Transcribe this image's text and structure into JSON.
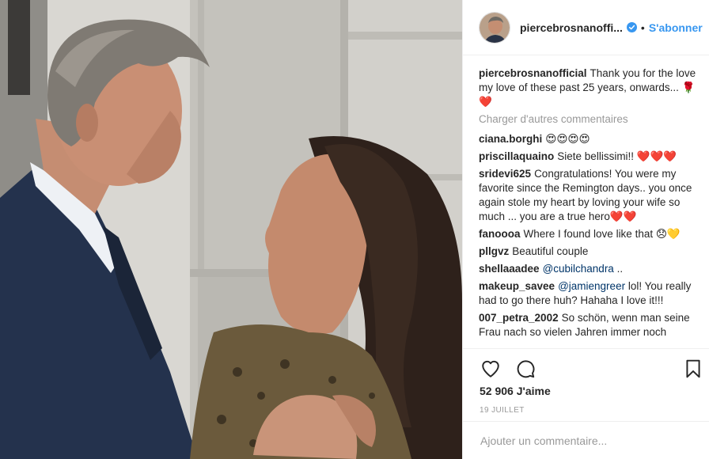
{
  "post": {
    "photo_alt": "photo-of-couple",
    "header": {
      "username": "piercebrosnanoffi...",
      "separator": "•",
      "follow_label": "S'abonner",
      "verified_icon": "verified-badge-icon"
    },
    "caption": {
      "user": "piercebrosnanofficial",
      "text": "Thank you for the love my love of these past 25 years, onwards... 🌹 ❤️"
    },
    "load_more_label": "Charger d'autres commentaires",
    "comments": [
      {
        "user": "ciana.borghi",
        "text": "😍😍😍😍"
      },
      {
        "user": "priscillaquaino",
        "text": "Siete bellissimi!! ❤️❤️❤️"
      },
      {
        "user": "sridevi625",
        "text": "Congratulations! You were my favorite since the Remington days.. you once again stole my heart by loving your wife so much ... you are a true hero❤️❤️"
      },
      {
        "user": "fanoooa",
        "text": "Where I found love like that 😞💛"
      },
      {
        "user": "pllgvz",
        "text": "Beautiful couple"
      },
      {
        "user": "shellaaadee",
        "mention": "@cubilchandra",
        "text": " .."
      },
      {
        "user": "makeup_savee",
        "mention": "@jamiengreer",
        "text": " lol! You really had to go there huh? Hahaha I love it!!!"
      },
      {
        "user": "007_petra_2002",
        "text": "So schön, wenn man seine Frau nach so vielen Jahren immer noch"
      }
    ],
    "actions": {
      "like_icon": "heart-outline-icon",
      "comment_icon": "speech-bubble-icon",
      "save_icon": "bookmark-icon"
    },
    "likes_text": "52 906 J'aime",
    "date_text": "19 JUILLET",
    "add_comment_placeholder": "Ajouter un commentaire..."
  },
  "colors": {
    "link_blue": "#3897f0",
    "text_dark": "#262626",
    "text_muted": "#999999",
    "border": "#efefef"
  }
}
